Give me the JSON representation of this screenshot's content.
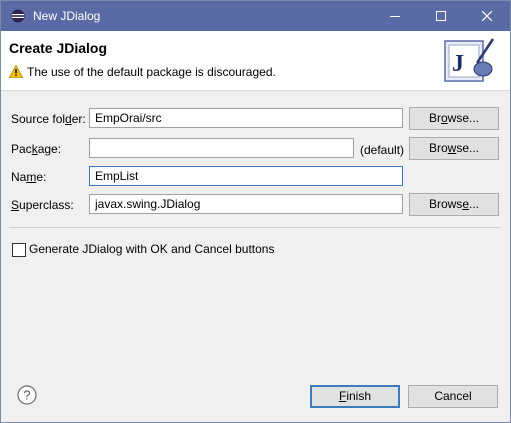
{
  "window": {
    "title": "New JDialog",
    "controls": [
      "minimize-icon",
      "maximize-icon",
      "close-icon"
    ]
  },
  "header": {
    "heading": "Create JDialog",
    "message": "The use of the default package is discouraged.",
    "message_icon": "warning-icon",
    "banner_icon": "java-wizard-icon",
    "banner_letter": "J"
  },
  "form": {
    "source_folder": {
      "label_pre": "Source fol",
      "label_mnemonic": "d",
      "label_post": "er:",
      "value": "EmpOrai/src",
      "browse_pre": "Br",
      "browse_mnemonic": "o",
      "browse_post": "wse..."
    },
    "package": {
      "label_pre": "Pac",
      "label_mnemonic": "k",
      "label_post": "age:",
      "value": "",
      "default_tag": "(default)",
      "browse_pre": "Bro",
      "browse_mnemonic": "w",
      "browse_post": "se..."
    },
    "name": {
      "label_pre": "Na",
      "label_mnemonic": "m",
      "label_post": "e:",
      "value": "EmpList"
    },
    "superclass": {
      "label_pre": "",
      "label_mnemonic": "S",
      "label_post": "uperclass:",
      "value": "javax.swing.JDialog",
      "browse_pre": "Brows",
      "browse_mnemonic": "e",
      "browse_post": "..."
    },
    "generate_checkbox": {
      "label": "Generate JDialog with OK and Cancel buttons",
      "checked": false
    }
  },
  "footer": {
    "help_icon": "help-icon",
    "finish_pre": "",
    "finish_mnemonic": "F",
    "finish_post": "inish",
    "cancel_label": "Cancel"
  },
  "colors": {
    "titlebar": "#5a6aa5",
    "dialog_bg": "#f0f0f0",
    "focus_border": "#3d7bbd",
    "warning": "#f2c200"
  }
}
